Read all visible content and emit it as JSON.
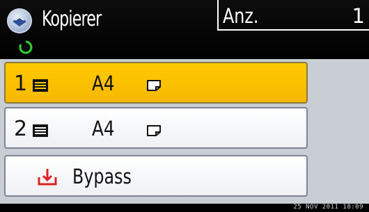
{
  "header": {
    "app_title": "Kopierer",
    "app_icon": "copier-icon",
    "status_icon": "ready-status-icon",
    "count_label": "Anz.",
    "count_value": "1"
  },
  "trays": [
    {
      "number": "1",
      "size": "A4",
      "icon": "paper-tray-icon",
      "orientation_icon": "landscape-paper-icon",
      "selected": true
    },
    {
      "number": "2",
      "size": "A4",
      "icon": "paper-tray-icon",
      "orientation_icon": "landscape-paper-icon",
      "selected": false
    }
  ],
  "bypass": {
    "label": "Bypass",
    "icon": "bypass-tray-icon",
    "icon_color": "#e02020"
  },
  "footer": {
    "datetime": "25 NOV   2011 18:09"
  },
  "colors": {
    "selected": "#ffca00",
    "panel": "#c9cdd4",
    "status_green": "#2fd22f"
  }
}
